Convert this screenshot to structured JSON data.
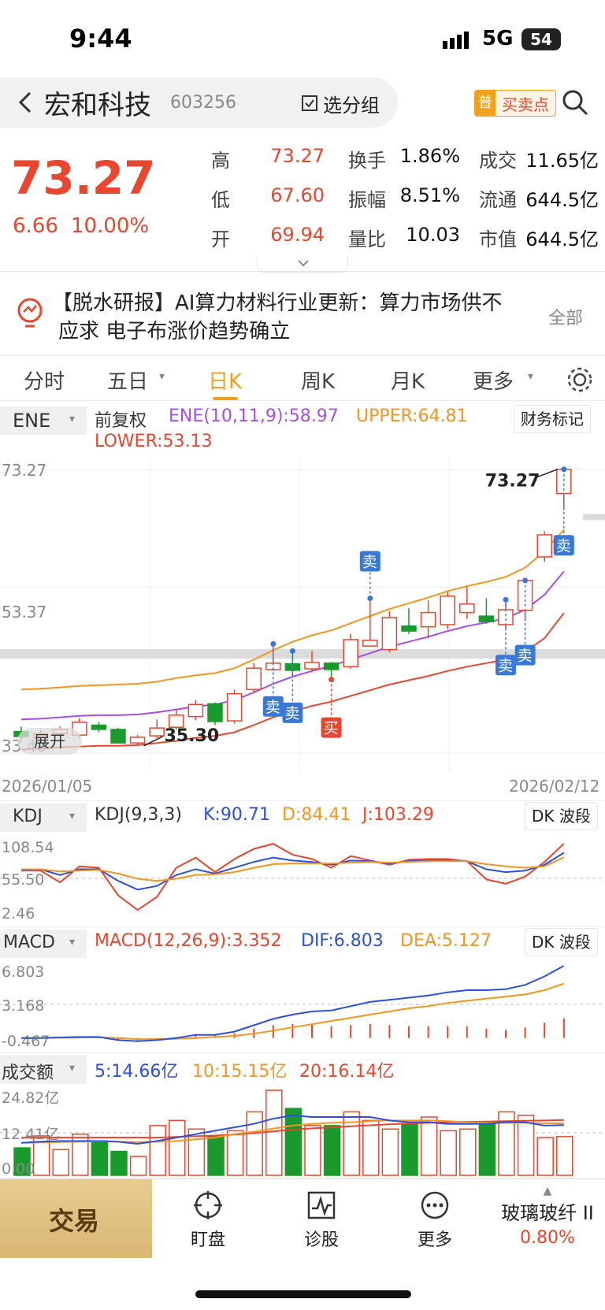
{
  "status": {
    "time": "9:44",
    "network": "5G",
    "battery": "54"
  },
  "header": {
    "title": "宏和科技",
    "code": "603256",
    "group_btn": "选分组",
    "badge_small": "普",
    "buysell_btn": "买卖点"
  },
  "quote": {
    "price": "73.27",
    "change": "6.66",
    "change_pct": "10.00%",
    "rows": [
      {
        "l1": "高",
        "v1": "73.27",
        "l2": "换手",
        "v2": "1.86%",
        "l3": "成交",
        "v3": "11.65亿"
      },
      {
        "l1": "低",
        "v1": "67.60",
        "l2": "振幅",
        "v2": "8.51%",
        "l3": "流通",
        "v3": "644.5亿"
      },
      {
        "l1": "开",
        "v1": "69.94",
        "l2": "量比",
        "v2": "10.03",
        "l3": "市值",
        "v3": "644.5亿"
      }
    ]
  },
  "news": {
    "text_line1": "【脱水研报】AI算力材料行业更新：算力市场供不",
    "text_line2": "应求 电子布涨价趋势确立",
    "all": "全部"
  },
  "tabs": [
    "分时",
    "五日",
    "日K",
    "周K",
    "月K",
    "更多"
  ],
  "active_tab": "日K",
  "kline": {
    "indicator": "ENE",
    "adj": "前复权",
    "ene": "ENE(10,11,9):58.97",
    "upper": "UPPER:64.81",
    "lower": "LOWER:53.13",
    "finance": "财务标记",
    "y_top": "73.27",
    "y_mid": "53.37",
    "y_bot": "33.48",
    "date_start": "2026/01/05",
    "date_end": "2026/02/12",
    "high_label": "73.27",
    "low_label": "35.30",
    "expand": "展开",
    "sell": "卖",
    "buy": "买"
  },
  "kdj": {
    "name": "KDJ",
    "params": "KDJ(9,3,3)",
    "k": "K:90.71",
    "d": "D:84.41",
    "j": "J:103.29",
    "badge": "DK 波段",
    "y1": "108.54",
    "y2": "55.50",
    "y3": "2.46"
  },
  "macd": {
    "name": "MACD",
    "params": "MACD(12,26,9):3.352",
    "dif": "DIF:6.803",
    "dea": "DEA:5.127",
    "badge": "DK 波段",
    "y1": "6.803",
    "y2": "3.168",
    "y3": "-0.467"
  },
  "volume": {
    "name": "成交额",
    "ma5": "5:14.66亿",
    "ma10": "10:15.15亿",
    "ma20": "20:16.14亿",
    "y1": "24.82亿",
    "y2": "12.41亿",
    "y3": "0.00"
  },
  "bottom": {
    "trade": "交易",
    "items": [
      "盯盘",
      "诊股",
      "更多"
    ],
    "sector": "玻璃玻纤 II",
    "sector_pct": "0.80%"
  },
  "chart_data": {
    "type": "candlestick",
    "candles": [
      {
        "o": 36.5,
        "c": 35.8,
        "h": 37.2,
        "l": 35.0
      },
      {
        "o": 35.6,
        "c": 36.2,
        "h": 36.8,
        "l": 35.2
      },
      {
        "o": 36.2,
        "c": 36.8,
        "h": 37.2,
        "l": 35.8
      },
      {
        "o": 36.0,
        "c": 37.8,
        "h": 38.4,
        "l": 35.6
      },
      {
        "o": 37.4,
        "c": 36.8,
        "h": 37.8,
        "l": 36.4
      },
      {
        "o": 36.8,
        "c": 34.9,
        "h": 37.0,
        "l": 34.8
      },
      {
        "o": 34.9,
        "c": 35.7,
        "h": 36.0,
        "l": 34.5
      },
      {
        "o": 35.9,
        "c": 37.0,
        "h": 38.2,
        "l": 35.6
      },
      {
        "o": 37.1,
        "c": 38.8,
        "h": 39.6,
        "l": 36.8
      },
      {
        "o": 38.6,
        "c": 40.3,
        "h": 40.9,
        "l": 38.1
      },
      {
        "o": 40.4,
        "c": 37.9,
        "h": 40.6,
        "l": 37.4
      },
      {
        "o": 38.0,
        "c": 41.8,
        "h": 42.4,
        "l": 37.6
      },
      {
        "o": 42.4,
        "c": 45.4,
        "h": 46.1,
        "l": 42.0
      },
      {
        "o": 45.2,
        "c": 46.1,
        "h": 48.8,
        "l": 45.0
      },
      {
        "o": 46.0,
        "c": 45.1,
        "h": 47.8,
        "l": 44.1
      },
      {
        "o": 45.3,
        "c": 46.2,
        "h": 47.8,
        "l": 44.8
      },
      {
        "o": 46.1,
        "c": 45.2,
        "h": 46.3,
        "l": 43.8
      },
      {
        "o": 45.6,
        "c": 49.4,
        "h": 50.2,
        "l": 45.3
      },
      {
        "o": 48.5,
        "c": 49.3,
        "h": 55.2,
        "l": 48.4
      },
      {
        "o": 48.0,
        "c": 52.5,
        "h": 53.4,
        "l": 47.6
      },
      {
        "o": 51.3,
        "c": 50.6,
        "h": 53.8,
        "l": 50.2
      },
      {
        "o": 51.2,
        "c": 53.2,
        "h": 54.9,
        "l": 49.6
      },
      {
        "o": 51.5,
        "c": 55.5,
        "h": 56.1,
        "l": 50.9
      },
      {
        "o": 53.2,
        "c": 54.4,
        "h": 56.8,
        "l": 52.3
      },
      {
        "o": 52.7,
        "c": 51.9,
        "h": 55.2,
        "l": 51.6
      },
      {
        "o": 51.5,
        "c": 53.6,
        "h": 55.0,
        "l": 50.8
      },
      {
        "o": 53.5,
        "c": 57.7,
        "h": 57.7,
        "l": 52.2
      },
      {
        "o": 61.0,
        "c": 64.1,
        "h": 64.6,
        "l": 60.3
      },
      {
        "o": 69.9,
        "c": 73.3,
        "h": 73.3,
        "l": 67.6
      }
    ],
    "ene": [
      38.2,
      38.3,
      38.5,
      38.7,
      38.8,
      38.8,
      38.9,
      39.2,
      39.6,
      40.0,
      40.3,
      40.9,
      42.0,
      43.2,
      44.2,
      45.0,
      45.7,
      46.6,
      47.5,
      48.4,
      49.1,
      49.8,
      50.6,
      51.3,
      51.8,
      52.4,
      53.6,
      55.7,
      58.97
    ],
    "upper": [
      42.4,
      42.5,
      42.7,
      42.9,
      43.0,
      43.1,
      43.2,
      43.5,
      44.0,
      44.4,
      44.7,
      45.4,
      46.6,
      47.9,
      49.1,
      50.0,
      50.7,
      51.7,
      52.7,
      53.7,
      54.5,
      55.3,
      56.2,
      56.9,
      57.5,
      58.2,
      59.5,
      61.8,
      64.81
    ],
    "lower": [
      34.0,
      34.1,
      34.3,
      34.4,
      34.5,
      34.5,
      34.6,
      34.9,
      35.2,
      35.6,
      35.9,
      36.4,
      37.4,
      38.5,
      39.3,
      40.1,
      40.7,
      41.5,
      42.3,
      43.1,
      43.7,
      44.3,
      45.0,
      45.6,
      46.1,
      46.6,
      47.7,
      49.6,
      53.13
    ],
    "y_range": [
      33.48,
      73.27
    ],
    "kdj": {
      "k": [
        67,
        68,
        60,
        68,
        68,
        52,
        40,
        45,
        60,
        68,
        62,
        70,
        78,
        84,
        80,
        78,
        74,
        80,
        79,
        76,
        79,
        80,
        80,
        79,
        68,
        64,
        66,
        74,
        90.71
      ],
      "d": [
        68,
        68,
        65,
        66,
        67,
        62,
        55,
        52,
        55,
        60,
        61,
        64,
        70,
        75,
        76,
        76,
        76,
        77,
        78,
        77,
        78,
        79,
        79,
        79,
        75,
        72,
        70,
        72,
        84.41
      ],
      "j": [
        66,
        66,
        50,
        72,
        70,
        32,
        12,
        30,
        70,
        84,
        64,
        82,
        96,
        103,
        88,
        82,
        70,
        86,
        80,
        74,
        81,
        82,
        82,
        79,
        54,
        48,
        58,
        78,
        103.29
      ],
      "y_range": [
        2.46,
        108.54
      ]
    },
    "macd": {
      "dif": [
        0.0,
        0.0,
        0.05,
        0.1,
        0.1,
        -0.2,
        -0.3,
        -0.2,
        0.0,
        0.3,
        0.3,
        0.6,
        1.2,
        1.8,
        2.2,
        2.5,
        2.6,
        3.0,
        3.4,
        3.6,
        3.8,
        4.0,
        4.3,
        4.5,
        4.5,
        4.6,
        5.0,
        5.8,
        6.803
      ],
      "dea": [
        0.0,
        0.0,
        0.02,
        0.04,
        0.06,
        0.0,
        -0.1,
        -0.1,
        -0.07,
        0.0,
        0.1,
        0.2,
        0.4,
        0.7,
        1.0,
        1.3,
        1.6,
        1.9,
        2.2,
        2.5,
        2.8,
        3.0,
        3.3,
        3.5,
        3.7,
        3.9,
        4.1,
        4.5,
        5.127
      ],
      "hist": [
        0.0,
        0.0,
        0.06,
        0.12,
        0.08,
        -0.4,
        -0.4,
        -0.2,
        0.14,
        0.6,
        0.4,
        0.8,
        1.6,
        2.2,
        2.4,
        2.4,
        2.0,
        2.2,
        2.4,
        2.2,
        2.0,
        2.0,
        2.0,
        2.0,
        1.6,
        1.4,
        1.8,
        2.6,
        3.352
      ],
      "y_range": [
        -0.467,
        6.803
      ]
    },
    "vol": {
      "values": [
        8,
        11.5,
        7.5,
        12,
        10,
        7,
        5.5,
        14.5,
        16,
        13.5,
        11.5,
        13,
        18.5,
        24.8,
        19.5,
        14.5,
        14.5,
        18.5,
        16,
        13.5,
        15,
        17,
        13,
        13.5,
        15,
        18.5,
        17.5,
        11,
        11.3
      ],
      "ma5": [
        9.5,
        9.8,
        10,
        10,
        10,
        9.8,
        9.2,
        10,
        11,
        12,
        13,
        14,
        15,
        16.5,
        17.5,
        17,
        17,
        17,
        17,
        16,
        15.5,
        15.5,
        15,
        15,
        15,
        15.5,
        15.5,
        14.5,
        14.66
      ],
      "ma10": [
        9.5,
        9.6,
        9.7,
        9.8,
        9.9,
        9.8,
        9.7,
        9.8,
        10,
        10.5,
        11,
        12,
        12.7,
        13.6,
        14.5,
        15,
        15.3,
        15.5,
        15.8,
        16,
        16,
        16,
        15.8,
        15.5,
        15.4,
        15.3,
        15.3,
        15.2,
        15.15
      ],
      "ma20": [
        11,
        11,
        11,
        11,
        11,
        11,
        11,
        11,
        11.2,
        11.4,
        11.6,
        11.9,
        12.3,
        12.8,
        13.3,
        13.7,
        14,
        14.3,
        14.6,
        14.9,
        15.1,
        15.3,
        15.5,
        15.6,
        15.7,
        15.8,
        15.9,
        16,
        16.14
      ],
      "y_range": [
        0,
        24.82
      ]
    },
    "markers": [
      {
        "idx": 13,
        "type": "sell"
      },
      {
        "idx": 14,
        "type": "sell"
      },
      {
        "idx": 16,
        "type": "buy"
      },
      {
        "idx": 18,
        "type": "sell"
      },
      {
        "idx": 25,
        "type": "sell"
      },
      {
        "idx": 26,
        "type": "sell"
      },
      {
        "idx": 28,
        "type": "sell"
      }
    ]
  },
  "colors": {
    "up": "#e8462e",
    "down": "#1a9a2c",
    "ene": "#a64ee6",
    "upper": "#f39521",
    "lower": "#e8462e",
    "k": "#2d4fe0",
    "d": "#f39521",
    "j": "#e8462e",
    "dif": "#2d4fe0",
    "dea": "#f39521",
    "accent": "#f0a21e",
    "marker": "#3a78d8"
  }
}
